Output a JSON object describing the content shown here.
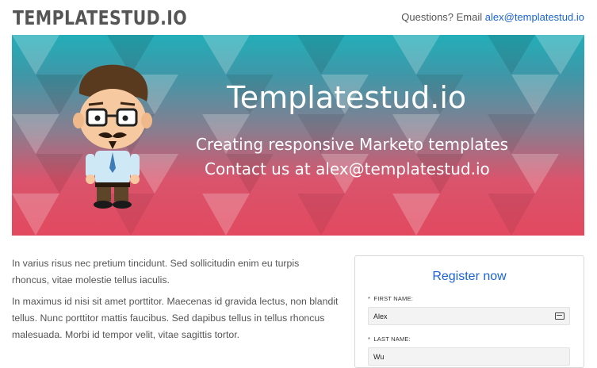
{
  "header": {
    "logo_text": "TEMPLATESTUD.IO",
    "contact_prefix": "Questions? Email",
    "contact_email": "alex@templatestud.io"
  },
  "hero": {
    "title": "Templatestud.io",
    "subtitle_line1": "Creating responsive Marketo templates",
    "subtitle_line2": "Contact us at alex@templatestud.io",
    "colors": {
      "top": "#23aeb8",
      "bottom": "#e2495f"
    }
  },
  "content": {
    "paragraph1": "In varius risus nec pretium tincidunt. Sed sollicitudin enim eu turpis rhoncus, vitae molestie tellus iaculis.",
    "paragraph2": "In maximus id nisi sit amet porttitor. Maecenas id gravida lectus, non blandit tellus. Nunc porttitor mattis faucibus. Sed dapibus tellus in tellus rhoncus malesuada. Morbi id tempor velit, vitae sagittis tortor."
  },
  "form": {
    "title": "Register now",
    "first_name_label": "FIRST NAME:",
    "first_name_value": "Alex",
    "last_name_label": "LAST NAME:",
    "last_name_value": "Wu",
    "required_marker": "*",
    "autofill_icon": "contact-card-icon"
  },
  "colors": {
    "link": "#1a62d6"
  }
}
